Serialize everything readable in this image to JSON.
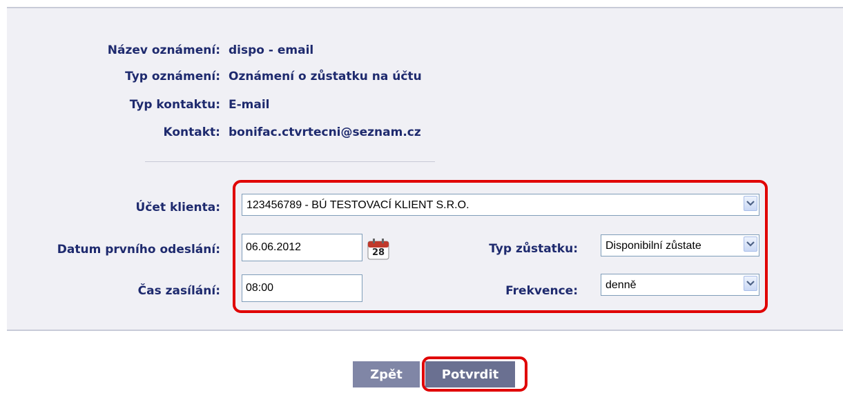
{
  "info": {
    "name_label": "Název oznámení:",
    "name_value": "dispo - email",
    "type_label": "Typ oznámení:",
    "type_value": "Oznámení o zůstatku na účtu",
    "contact_type_label": "Typ kontaktu:",
    "contact_type_value": "E-mail",
    "contact_label": "Kontakt:",
    "contact_value": "bonifac.ctvrtecni@seznam.cz"
  },
  "form": {
    "account_label": "Účet klienta:",
    "account_value": "123456789 - BÚ TESTOVACÍ KLIENT S.R.O.",
    "first_send_label": "Datum prvního odeslání:",
    "first_send_value": "06.06.2012",
    "calendar_day": "28",
    "balance_type_label": "Typ zůstatku:",
    "balance_type_value": "Disponibilní zůstate",
    "send_time_label": "Čas zasílání:",
    "send_time_value": "08:00",
    "frequency_label": "Frekvence:",
    "frequency_value": "denně"
  },
  "buttons": {
    "back": "Zpět",
    "confirm": "Potvrdit"
  },
  "colors": {
    "highlight": "#e00000",
    "label_text": "#1e2a6e",
    "button_bg": "#7a809f",
    "panel_bg": "#f0f0f5"
  }
}
